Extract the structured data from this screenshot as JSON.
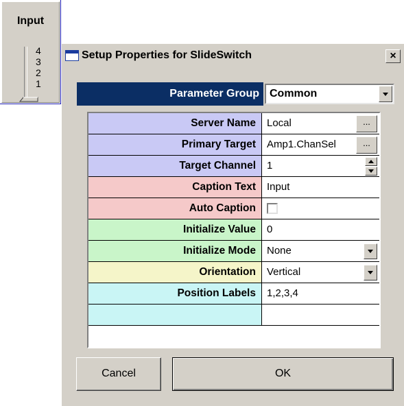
{
  "widget": {
    "title": "Input",
    "labels": [
      "4",
      "3",
      "2",
      "1"
    ]
  },
  "dialog": {
    "title": "Setup Properties for SlideSwitch",
    "close_label": "×",
    "parameter_group": {
      "label": "Parameter Group",
      "value": "Common"
    },
    "rows": [
      {
        "label": "Server Name",
        "value": "Local",
        "control": "ellipsis",
        "color": "#c9c9f5"
      },
      {
        "label": "Primary Target",
        "value": "Amp1.ChanSel",
        "control": "ellipsis",
        "color": "#c9c9f5"
      },
      {
        "label": "Target Channel",
        "value": "1",
        "control": "spin",
        "color": "#c9c9f5"
      },
      {
        "label": "Caption Text",
        "value": "Input",
        "control": "text",
        "color": "#f5c9c9"
      },
      {
        "label": "Auto Caption",
        "value": "",
        "control": "checkbox",
        "color": "#f5c9c9"
      },
      {
        "label": "Initialize Value",
        "value": "0",
        "control": "text",
        "color": "#c9f5c9"
      },
      {
        "label": "Initialize Mode",
        "value": "None",
        "control": "dropdown",
        "color": "#c9f5c9"
      },
      {
        "label": "Orientation",
        "value": "Vertical",
        "control": "dropdown",
        "color": "#f5f5c9"
      },
      {
        "label": "Position Labels",
        "value": "1,2,3,4",
        "control": "text",
        "color": "#c9f5f5"
      },
      {
        "label": "",
        "value": "",
        "control": "text",
        "color": "#c9f5f5"
      }
    ],
    "ellipsis_label": "...",
    "buttons": {
      "cancel": "Cancel",
      "ok": "OK"
    }
  }
}
